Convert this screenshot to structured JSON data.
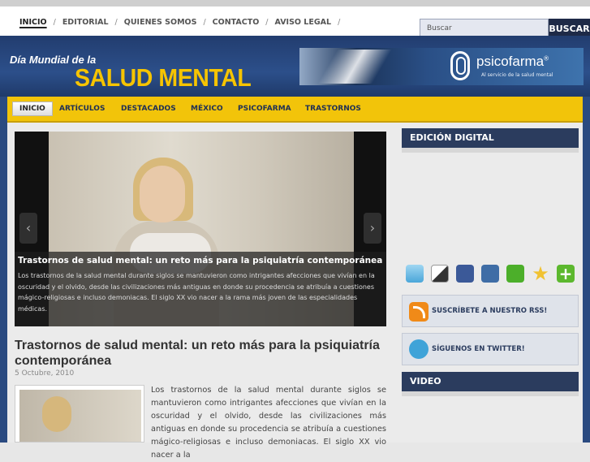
{
  "top_nav": {
    "items": [
      {
        "label": "INICIO"
      },
      {
        "label": "EDITORIAL"
      },
      {
        "label": "QUIENES SOMOS"
      },
      {
        "label": "CONTACTO"
      },
      {
        "label": "AVISO LEGAL"
      }
    ],
    "separator": "/"
  },
  "search": {
    "placeholder": "Buscar",
    "button": "BUSCAR"
  },
  "header": {
    "title_small": "Día Mundial de la",
    "title_big": "SALUD MENTAL",
    "banner_brand": "psicofarma",
    "banner_registered": "®",
    "banner_tagline": "Al servicio de la salud mental"
  },
  "main_nav": {
    "items": [
      "INICIO",
      "ARTÍCULOS",
      "DESTACADOS",
      "MÉXICO",
      "PSICOFARMA",
      "TRASTORNOS"
    ]
  },
  "slider": {
    "caption_title": "Trastornos de salud mental: un reto más para la psiquiatría contemporánea",
    "caption_text": "Los trastornos de la salud mental durante siglos se mantuvieron como intrigantes afecciones que vivían en la oscuridad y el olvido, desde las civilizaciones más antiguas en donde su procedencia se atribuía a cuestiones mágico-religiosas e incluso demoniacas. El siglo XX vio nacer a la rama más joven de las especialidades médicas.",
    "prev_arrow": "‹",
    "next_arrow": "›"
  },
  "post": {
    "title": "Trastornos de salud mental: un reto más para la psiquiatría contemporánea",
    "date": "5 Octubre, 2010",
    "excerpt": "Los trastornos de la salud mental durante siglos se mantuvieron como intrigantes afecciones que vivían en la oscuridad y el olvido, desde las civilizaciones más antiguas en donde su procedencia se atribuía a cuestiones mágico-religiosas e incluso demoniacas. El siglo XX vio nacer a la"
  },
  "sidebar": {
    "edicion_title": "EDICIÓN DIGITAL",
    "social_icons": [
      "twitter-icon",
      "delicious-icon",
      "facebook-icon",
      "digg-icon",
      "stumbleupon-icon",
      "favorite-star-icon",
      "add-icon"
    ],
    "rss_label": "SUSCRÍBETE A NUESTRO RSS!",
    "twitter_label": "SÍGUENOS EN TWITTER!",
    "video_title": "VIDEO"
  },
  "colors": {
    "accent_yellow": "#f2c40a",
    "header_blue": "#2c4f8a",
    "widget_navy": "#2b3c5e"
  }
}
